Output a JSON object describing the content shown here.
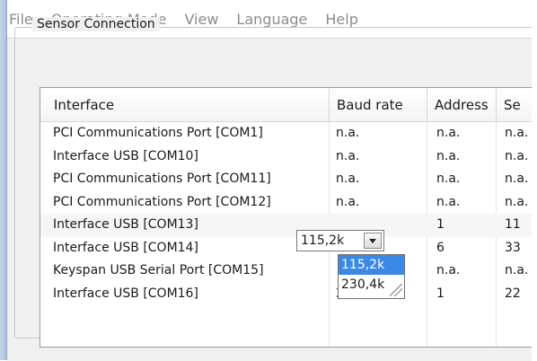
{
  "menu": [
    "File",
    "Operating Mode",
    "View",
    "Language",
    "Help"
  ],
  "group_title": "Sensor Connection",
  "columns": [
    "Interface",
    "Baud rate",
    "Address",
    "Se"
  ],
  "rows": [
    {
      "interface": "PCI Communications Port   [COM1]",
      "baud": "n.a.",
      "address": "n.a.",
      "s": "n.a."
    },
    {
      "interface": "Interface USB   [COM10]",
      "baud": "n.a.",
      "address": "n.a.",
      "s": "n.a."
    },
    {
      "interface": "PCI Communications Port   [COM11]",
      "baud": "n.a.",
      "address": "n.a.",
      "s": "n.a."
    },
    {
      "interface": "PCI Communications Port   [COM12]",
      "baud": "n.a.",
      "address": "n.a.",
      "s": "n.a."
    },
    {
      "interface": "Interface USB   [COM13]",
      "baud": "",
      "address": "1",
      "s": "11"
    },
    {
      "interface": "Interface USB   [COM14]",
      "baud": "",
      "address": "6",
      "s": "33"
    },
    {
      "interface": "Keyspan USB Serial Port   [COM15]",
      "baud": "",
      "address": "n.a.",
      "s": "n.a."
    },
    {
      "interface": "Interface USB   [COM16]",
      "baud": "230,4k",
      "address": "1",
      "s": "22"
    }
  ],
  "combo": {
    "value": "115,2k",
    "arrow_icon": "chevron-down-icon"
  },
  "dropdown": {
    "options": [
      "115,2k",
      "230,4k"
    ],
    "selected": "115,2k"
  }
}
